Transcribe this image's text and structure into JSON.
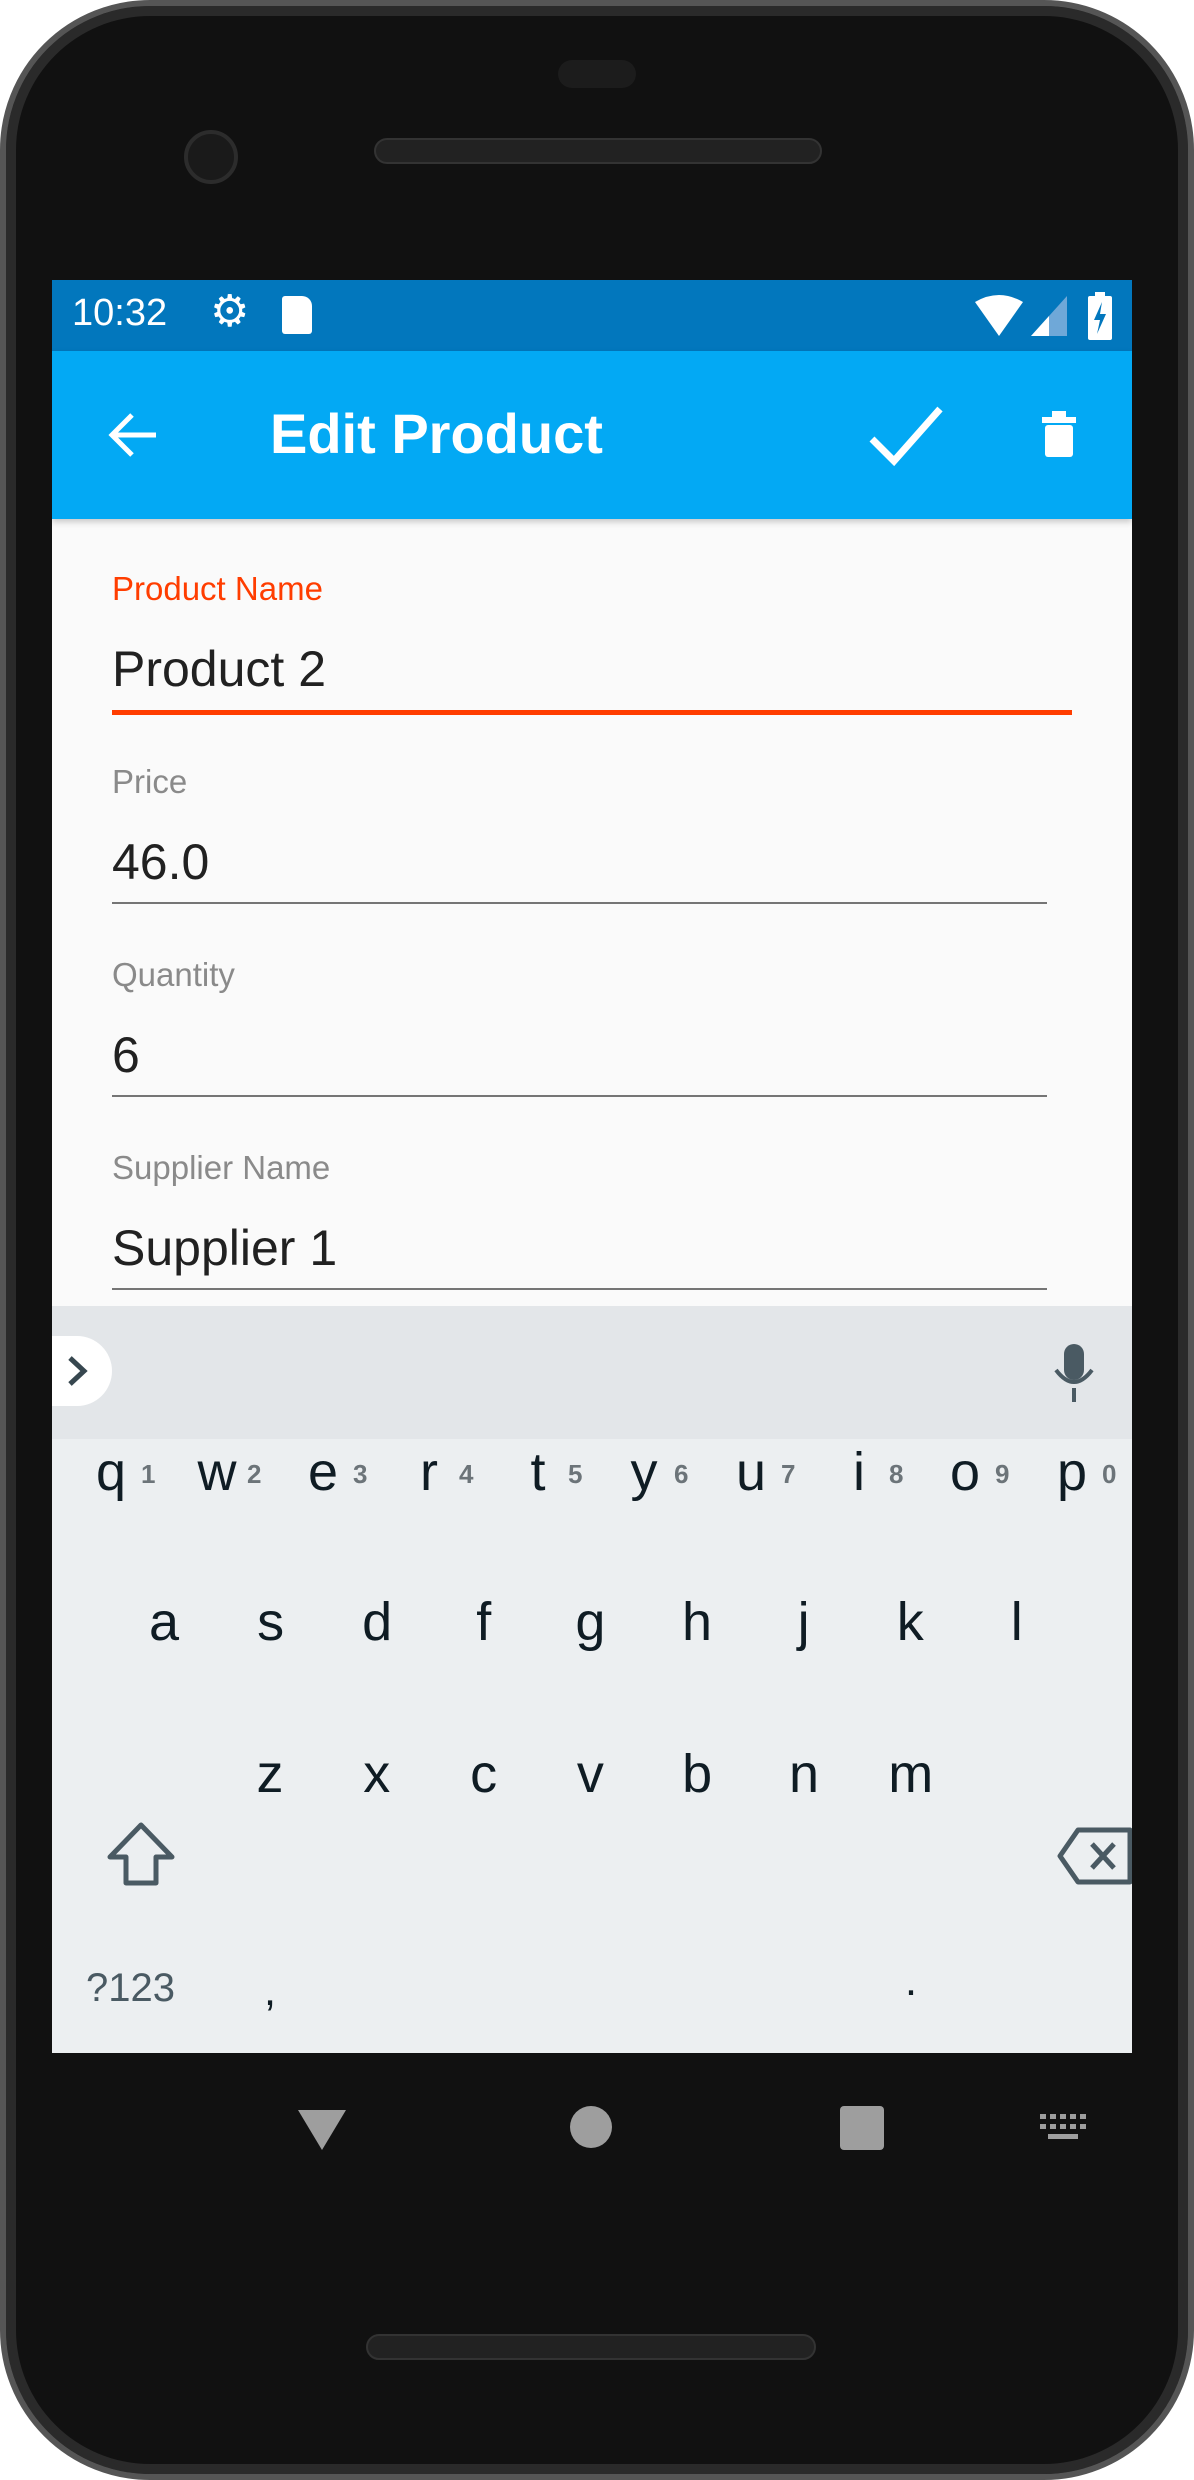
{
  "status_bar": {
    "time": "10:32",
    "icons": [
      "gear-icon",
      "sd-card-icon",
      "wifi-icon",
      "signal-icon",
      "battery-charging-icon"
    ]
  },
  "app_bar": {
    "title": "Edit Product",
    "back_icon": "arrow-left-icon",
    "save_icon": "check-icon",
    "delete_icon": "trash-icon"
  },
  "form": {
    "fields": [
      {
        "label": "Product Name",
        "value": "Product 2",
        "focused": true
      },
      {
        "label": "Price",
        "value": "46.0"
      },
      {
        "label": "Quantity",
        "value": "6"
      },
      {
        "label": "Supplier Name",
        "value": "Supplier 1"
      }
    ],
    "accent": "#ff3d00"
  },
  "keyboard": {
    "row1": [
      "q",
      "w",
      "e",
      "r",
      "t",
      "y",
      "u",
      "i",
      "o",
      "p"
    ],
    "hints": [
      "1",
      "2",
      "3",
      "4",
      "5",
      "6",
      "7",
      "8",
      "9",
      "0"
    ],
    "row2": [
      "a",
      "s",
      "d",
      "f",
      "g",
      "h",
      "j",
      "k",
      "l"
    ],
    "row3": [
      "z",
      "x",
      "c",
      "v",
      "b",
      "n",
      "m"
    ],
    "symbols": "?123",
    "comma": ",",
    "period": ".",
    "enter_color": "#4db6ac"
  },
  "colors": {
    "status": "#0277bd",
    "appbar": "#03a9f4"
  }
}
